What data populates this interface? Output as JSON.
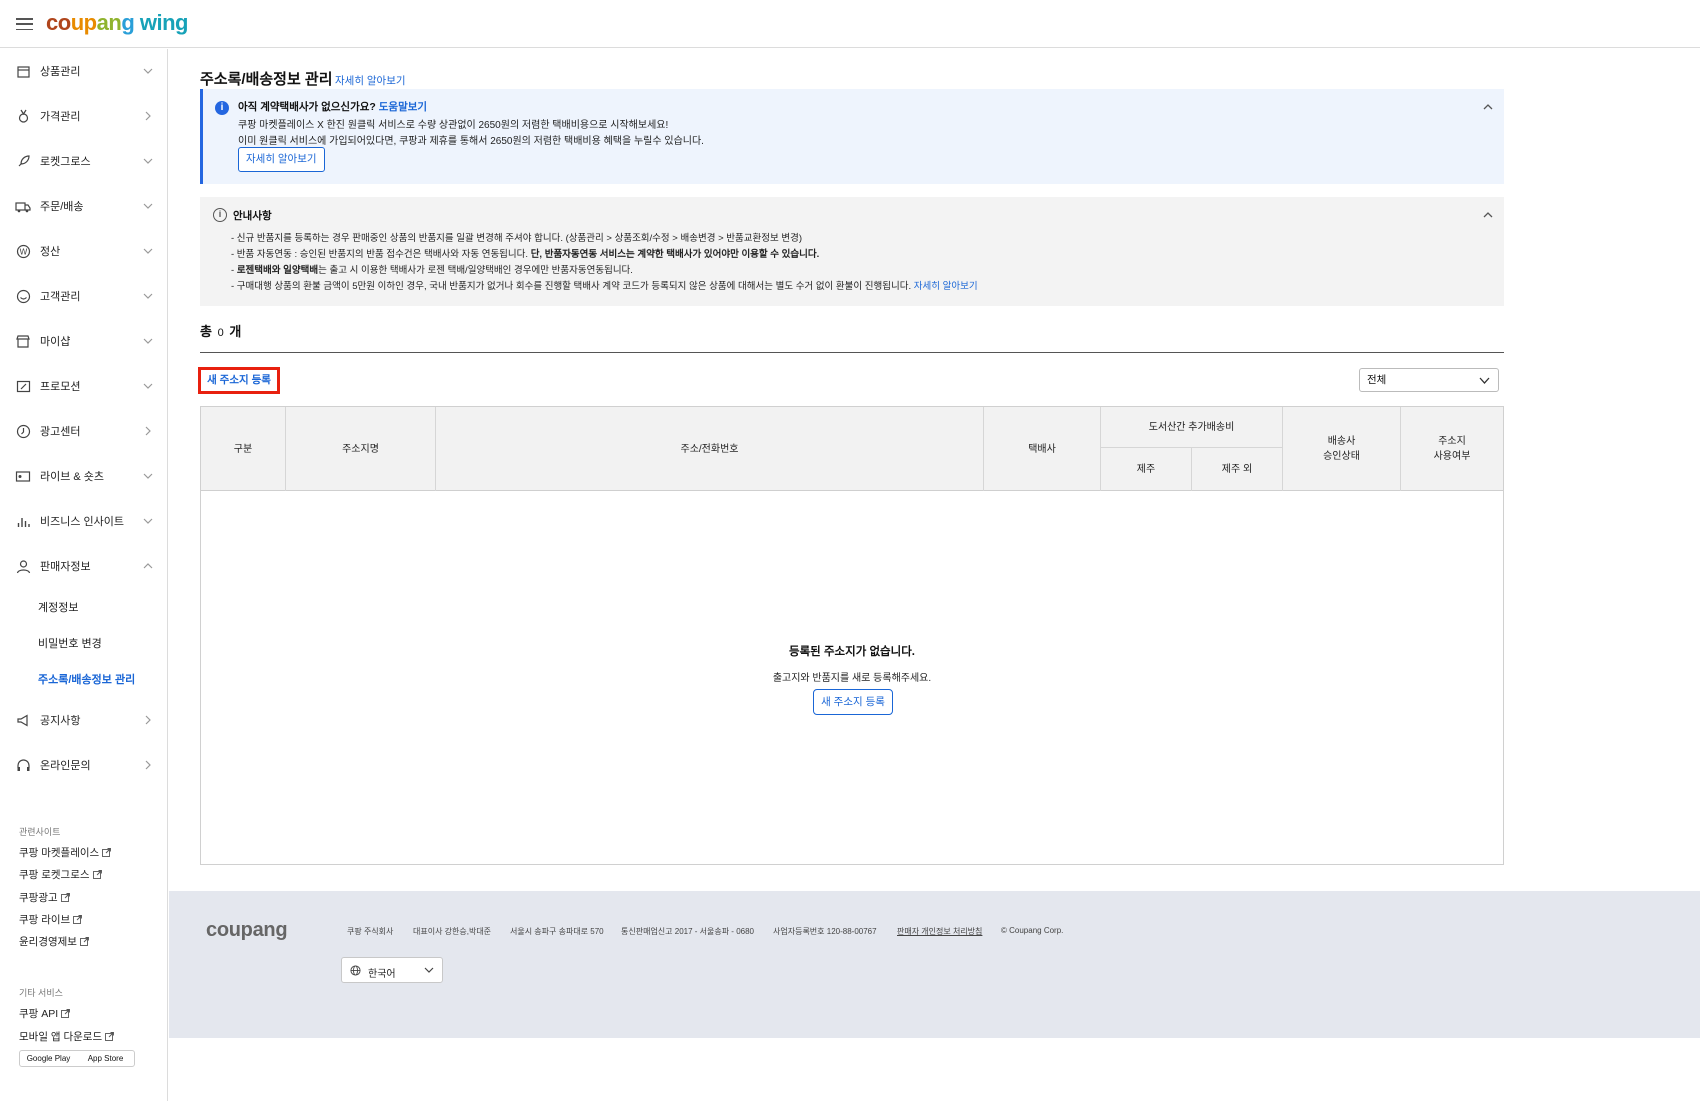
{
  "header": {
    "logo": "coupang wing"
  },
  "sidebar": {
    "menu": [
      {
        "label": "상품관리",
        "icon": "box-icon",
        "chevron": "down"
      },
      {
        "label": "가격관리",
        "icon": "medal-icon",
        "chevron": "right"
      },
      {
        "label": "로켓그로스",
        "icon": "rocket-icon",
        "chevron": "down"
      },
      {
        "label": "주문/배송",
        "icon": "truck-icon",
        "chevron": "down"
      },
      {
        "label": "정산",
        "icon": "won-icon",
        "chevron": "down"
      },
      {
        "label": "고객관리",
        "icon": "smile-icon",
        "chevron": "down"
      },
      {
        "label": "마이샵",
        "icon": "shop-icon",
        "chevron": "down"
      },
      {
        "label": "프로모션",
        "icon": "coupon-icon",
        "chevron": "down"
      },
      {
        "label": "광고센터",
        "icon": "ad-icon",
        "chevron": "right"
      },
      {
        "label": "라이브 & 숏츠",
        "icon": "live-icon",
        "chevron": "down"
      },
      {
        "label": "비즈니스 인사이트",
        "icon": "chart-icon",
        "chevron": "down"
      },
      {
        "label": "판매자정보",
        "icon": "user-icon",
        "chevron": "up"
      }
    ],
    "submenu": [
      "계정정보",
      "비밀번호 변경",
      "주소록/배송정보 관리"
    ],
    "menu_bottom": [
      {
        "label": "공지사항",
        "icon": "megaphone-icon",
        "chevron": "right"
      },
      {
        "label": "온라인문의",
        "icon": "headset-icon",
        "chevron": "right"
      }
    ],
    "related_title": "관련사이트",
    "related": [
      "쿠팡 마켓플레이스",
      "쿠팡 로켓그로스",
      "쿠팡광고",
      "쿠팡 라이브",
      "윤리경영제보"
    ],
    "other_title": "기타 서비스",
    "other": [
      "쿠팡 API",
      "모바일 앱 다운로드"
    ],
    "store_badges": [
      "Google Play",
      "App Store"
    ]
  },
  "main": {
    "title": "주소록/배송정보 관리",
    "title_link": "자세히 알아보기",
    "notice_blue": {
      "heading": "아직 계약택배사가 없으신가요?",
      "heading_link": "도움말보기",
      "line1": "쿠팡 마켓플레이스 X 한진 원클릭 서비스로 수량 상관없이 2650원의 저렴한 택배비용으로 시작해보세요!",
      "line2": "이미 원클릭 서비스에 가입되어있다면, 쿠팡과 제휴를 통해서 2650원의 저렴한 택배비용 혜택을 누릴수 있습니다.",
      "button": "자세히 알아보기"
    },
    "notice_gray": {
      "title": "안내사항",
      "line1": "- 신규 반품지를 등록하는 경우 판매중인 상품의 반품지를 일괄 변경해 주셔야 합니다. (상품관리 > 상품조회/수정 > 배송변경 > 반품교환정보 변경)",
      "line2_a": "- 반품 자동연동 : 승인된 반품지의 반품 접수건은 택배사와 자동 연동됩니다. ",
      "line2_b": "단, 반품자동연동 서비스는 계약한 택배사가 있어야만 이용할 수 있습니다.",
      "line3_a": "- ",
      "line3_b": "로젠택배와 일양택배",
      "line3_c": "는 출고 시 이용한 택배사가 로젠 택배/일양택배인 경우에만 반품자동연동됩니다.",
      "line4": "- 구매대행 상품의 환불 금액이 5만원 이하인 경우, 국내 반품지가 없거나 회수를 진행할 택배사 계약 코드가 등록되지 않은 상품에 대해서는 별도 수거 없이 환불이 진행됩니다. ",
      "line4_link": "자세히 알아보기"
    },
    "total_prefix": "총",
    "total_count": "0",
    "total_suffix": "개",
    "new_address_button": "새 주소지 등록",
    "filter_value": "전체",
    "table": {
      "headers": {
        "type": "구분",
        "name": "주소지명",
        "address": "주소/전화번호",
        "courier": "택배사",
        "island_fee": "도서산간 추가배송비",
        "jeju": "제주",
        "non_jeju": "제주 외",
        "approval_1": "배송사",
        "approval_2": "승인상태",
        "usage_1": "주소지",
        "usage_2": "사용여부"
      },
      "empty_title": "등록된 주소지가 없습니다.",
      "empty_sub": "출고지와 반품지를 새로 등록해주세요.",
      "empty_button": "새 주소지 등록"
    }
  },
  "footer": {
    "logo": "coupang",
    "company": "쿠팡 주식회사",
    "ceo": "대표이사 강한승,박대준",
    "address": "서울시 송파구 송파대로 570",
    "telecom": "통신판매업신고 2017 - 서울송파 - 0680",
    "business_no": "사업자등록번호 120-88-00767",
    "privacy": "판매자 개인정보 처리방침",
    "copyright": "© Coupang Corp.",
    "language": "한국어"
  },
  "colors": {
    "accent": "#1a66d6",
    "highlight_box": "#e8200f"
  }
}
